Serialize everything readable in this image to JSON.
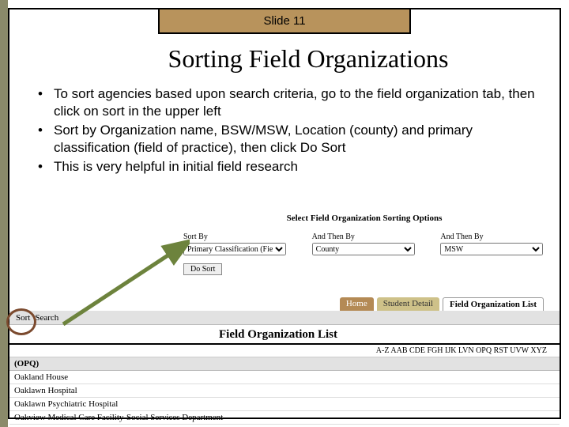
{
  "slide_label": "Slide 11",
  "title": "Sorting Field Organizations",
  "bullets": [
    "To sort agencies based upon search criteria, go to the field organization tab, then click on sort in the upper left",
    "Sort by Organization name, BSW/MSW, Location (county) and primary classification (field of practice), then click Do Sort",
    "This is very helpful in initial field research"
  ],
  "sort_panel": {
    "header": "Select Field Organization Sorting Options",
    "col1_label": "Sort By",
    "col1_value": "Primary Classification (Field of Practic",
    "col2_label": "And Then By",
    "col2_value": "County",
    "col3_label": "And Then By",
    "col3_value": "MSW",
    "button": "Do Sort"
  },
  "tabs": {
    "home": "Home",
    "student": "Student Detail",
    "fol": "Field Organization List"
  },
  "gray_bar": {
    "sort": "Sort",
    "search": "Search"
  },
  "list": {
    "title": "Field Organization List",
    "az": "A-Z  AAB  CDE  FGH  IJK  LVN  OPQ  RST  UVW  XYZ",
    "group": "(OPQ)",
    "items": [
      "Oakland House",
      "Oaklawn Hospital",
      "Oaklawn Psychiatric Hospital",
      "Oakview Medical Care Facility-Social Services Department"
    ]
  }
}
